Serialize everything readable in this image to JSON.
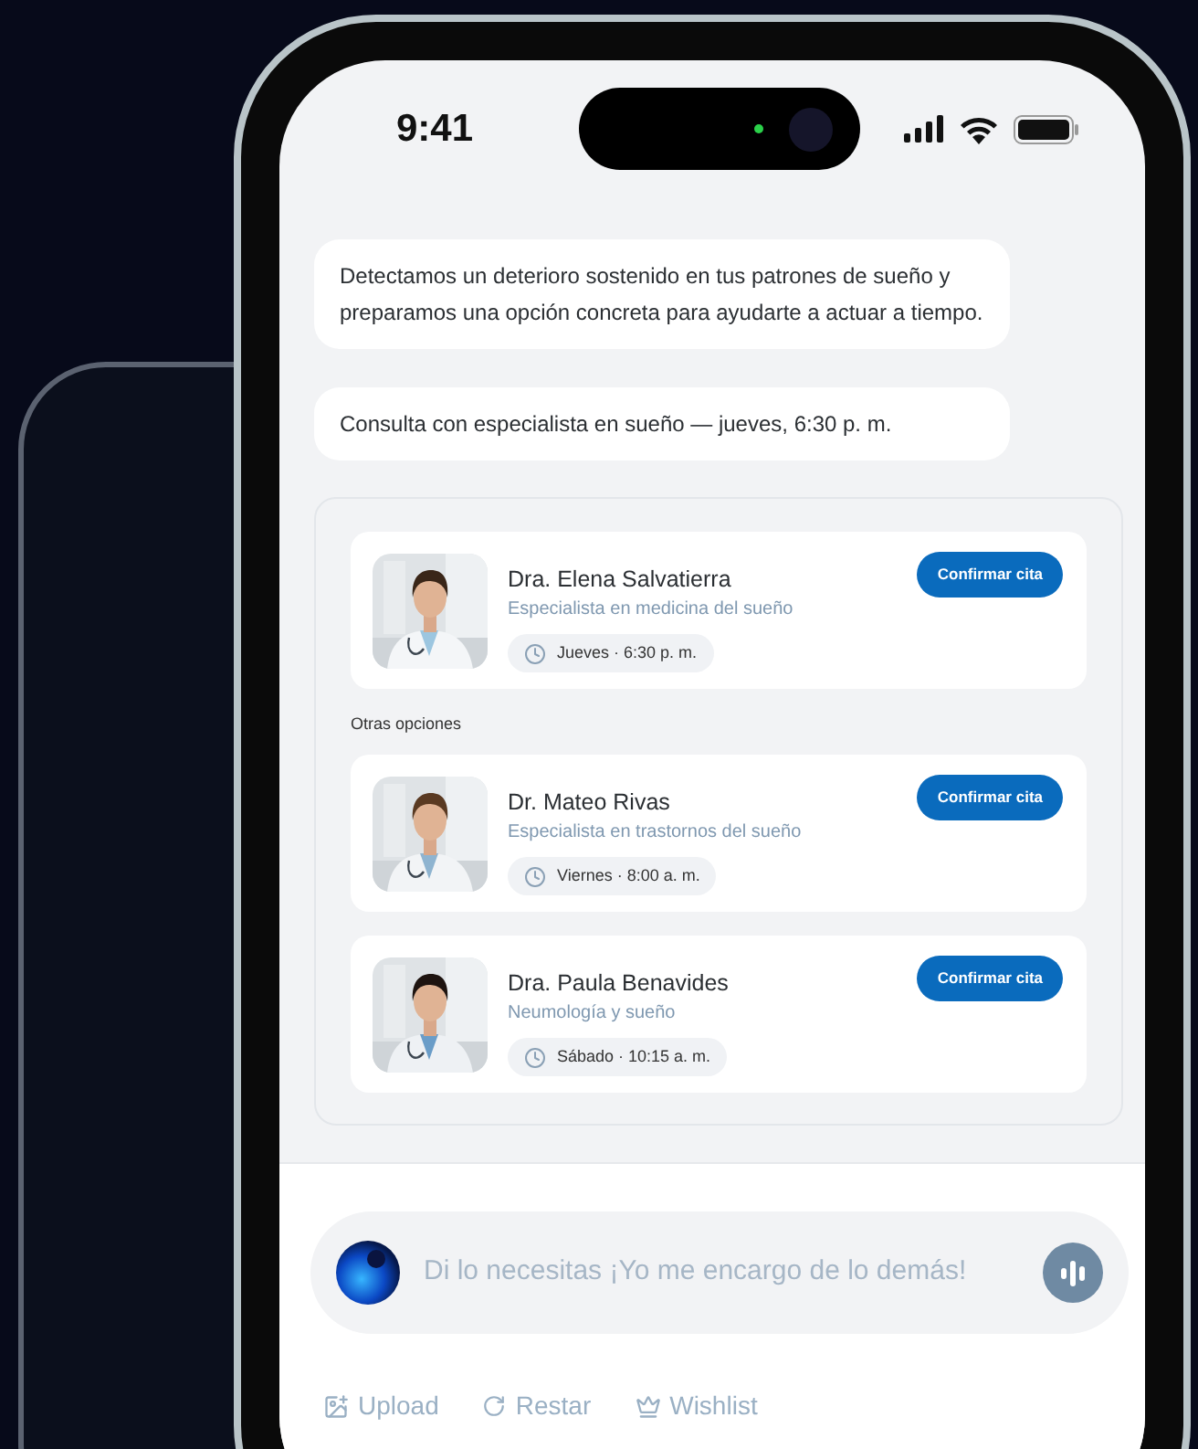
{
  "status_bar": {
    "time": "9:41"
  },
  "messages": [
    {
      "text": "Detectamos un deterioro sostenido en tus patrones de sueño y preparamos una opción concreta para ayudarte a actuar a tiempo."
    },
    {
      "text": "Consulta con especialista en sueño — jueves, 6:30 p. m."
    }
  ],
  "recommendation": {
    "primary": {
      "name": "Dra. Elena Salvatierra",
      "specialty": "Especialista en medicina del sueño",
      "slot": "Jueves · 6:30 p. m.",
      "button": "Confirmar cita"
    },
    "others_label": "Otras opciones",
    "others": [
      {
        "name": "Dr. Mateo Rivas",
        "specialty": "Especialista en trastornos del sueño",
        "slot": "Viernes · 8:00 a. m.",
        "button": "Confirmar cita"
      },
      {
        "name": "Dra. Paula Benavides",
        "specialty": "Neumología y sueño",
        "slot": "Sábado · 10:15 a. m.",
        "button": "Confirmar cita"
      }
    ]
  },
  "composer": {
    "placeholder": "Di lo necesitas ¡Yo me encargo de lo demás!"
  },
  "actions": [
    {
      "kind": "upload",
      "label": "Upload"
    },
    {
      "kind": "restart",
      "label": "Restar"
    },
    {
      "kind": "wishlist",
      "label": "Wishlist"
    }
  ]
}
